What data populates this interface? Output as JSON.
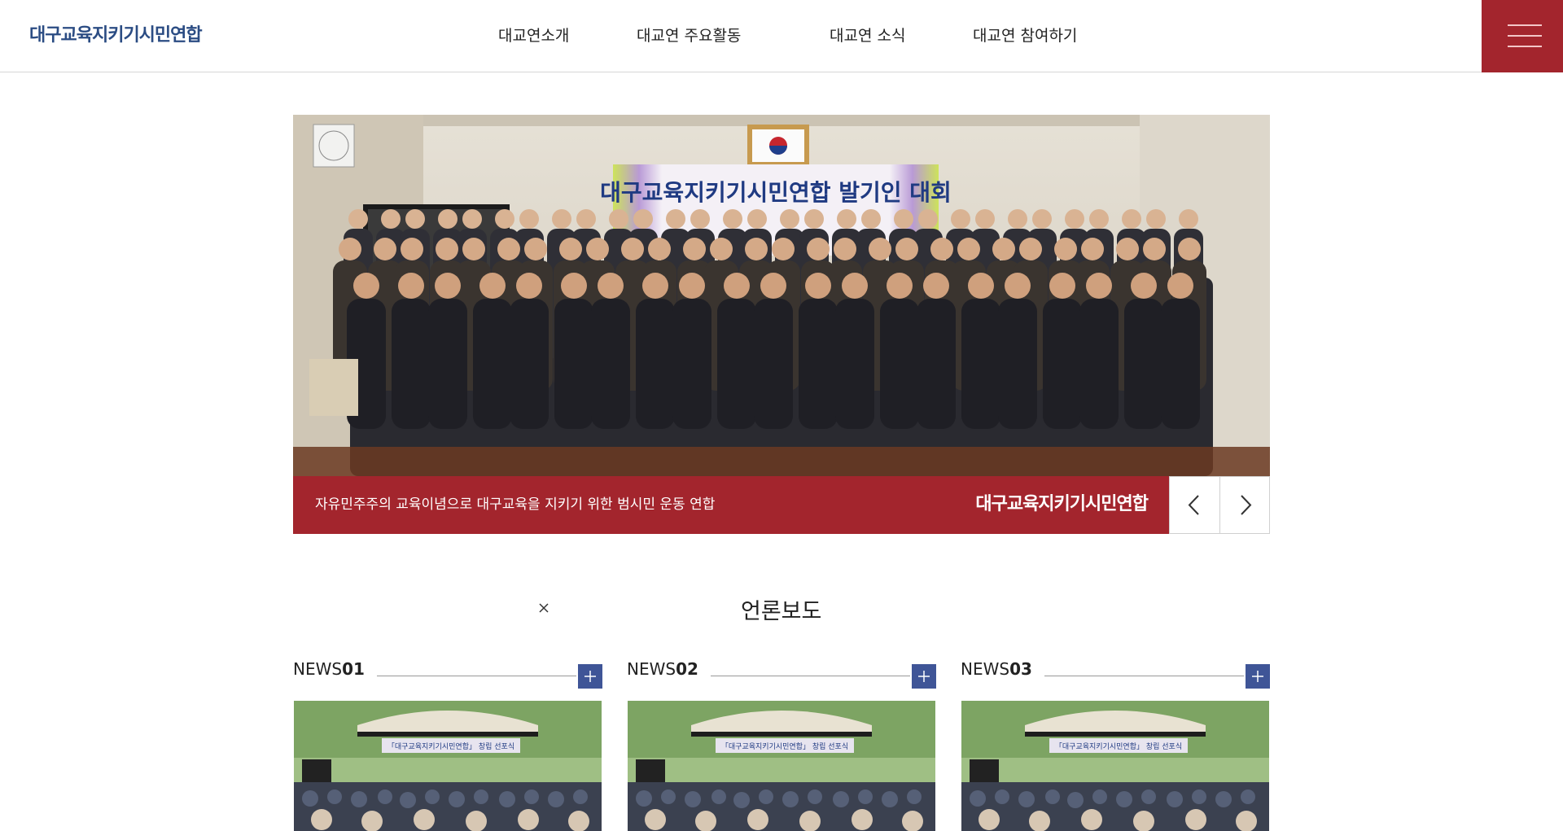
{
  "header": {
    "logo_text": "대구교육지키기시민연합",
    "nav": [
      {
        "label": "대교연소개"
      },
      {
        "label": "대교연 주요활동"
      },
      {
        "label": "대교연 소식"
      },
      {
        "label": "대교연 참여하기"
      }
    ],
    "menu_icon": "hamburger-icon"
  },
  "hero": {
    "banner_text": "대구교육지키기시민연합 발기인 대회",
    "caption": "자유민주주의 교육이념으로 대구교육을 지키기 위한 범시민 운동 연합",
    "caption_logo": "대구교육지키기시민연합",
    "prev_icon": "chevron-left-icon",
    "next_icon": "chevron-right-icon"
  },
  "section": {
    "title": "언론보도",
    "close_icon": "close-icon"
  },
  "news": [
    {
      "prefix": "NEWS",
      "num": "01",
      "banner": "「대구교육지키기시민연합」 창립 선포식"
    },
    {
      "prefix": "NEWS",
      "num": "02",
      "banner": "「대구교육지키기시민연합」 창립 선포식"
    },
    {
      "prefix": "NEWS",
      "num": "03",
      "banner": "「대구교육지키기시민연합」 창립 선포식"
    }
  ],
  "colors": {
    "brand_red": "#a3252d",
    "brand_blue": "#3f5597",
    "logo_blue": "#2b4c83"
  }
}
